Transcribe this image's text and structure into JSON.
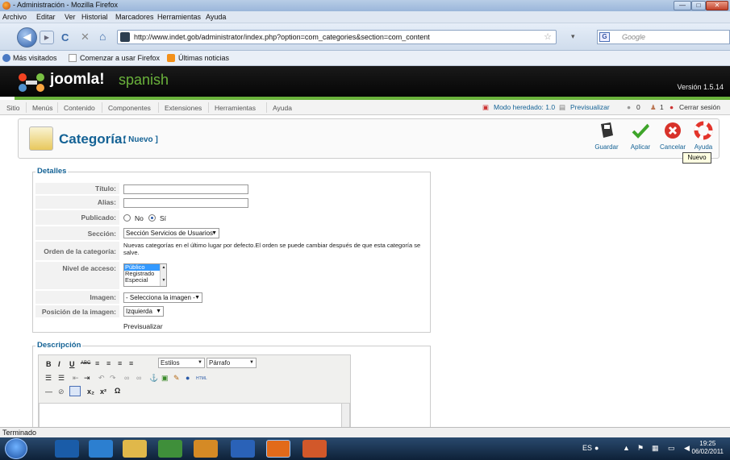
{
  "window": {
    "title": "- Administración - Mozilla Firefox",
    "min": "—",
    "max": "□",
    "close": "✕"
  },
  "menubar": [
    "Archivo",
    "Editar",
    "Ver",
    "Historial",
    "Marcadores",
    "Herramientas",
    "Ayuda"
  ],
  "nav": {
    "back": "◀",
    "forward": "▶",
    "reload": "C",
    "stop": "✕",
    "home": "⌂",
    "url": "http://www.indet.gob/administrator/index.php?option=com_categories&section=com_content",
    "search_placeholder": "Google"
  },
  "bookmarks": [
    "Más visitados",
    "Comenzar a usar Firefox",
    "Últimas noticias"
  ],
  "joomla": {
    "logo_main": "joomla!",
    "logo_sub": "spanish",
    "version": "Versión 1.5.14",
    "menu": [
      "Sitio",
      "Menús",
      "Contenido",
      "Componentes",
      "Extensiones",
      "Herramientas",
      "Ayuda"
    ],
    "status": {
      "legacy": "Modo heredado: 1.0",
      "preview": "Previsualizar",
      "messages": "0",
      "users": "1",
      "logout": "Cerrar sesión"
    }
  },
  "toolbar": {
    "title": "Categoría:",
    "subtitle": "[ Nuevo ]",
    "buttons": [
      {
        "label": "Guardar",
        "icon": "save-icon"
      },
      {
        "label": "Aplicar",
        "icon": "apply-icon"
      },
      {
        "label": "Cancelar",
        "icon": "cancel-icon"
      },
      {
        "label": "Ayuda",
        "icon": "help-icon"
      }
    ],
    "tooltip": "Nuevo"
  },
  "detalles": {
    "legend": "Detalles",
    "titulo_label": "Título:",
    "alias_label": "Alias:",
    "publicado_label": "Publicado:",
    "publicado_no": "No",
    "publicado_si": "Sí",
    "publicado_value": "Sí",
    "seccion_label": "Sección:",
    "seccion_value": "Sección Servicios de Usuarios",
    "orden_label": "Orden de la categoría:",
    "orden_text": "Nuevas categorías en el último lugar por defecto.El orden se puede cambiar después de que esta categoría se salve.",
    "nivel_label": "Nivel de acceso:",
    "nivel_options": [
      "Público",
      "Registrado",
      "Especial"
    ],
    "nivel_selected": "Público",
    "imagen_label": "Imagen:",
    "imagen_value": "- Selecciona la imagen -",
    "posicion_label": "Posición de la imagen:",
    "posicion_value": "Izquierda",
    "previsualizar": "Previsualizar"
  },
  "descripcion": {
    "legend": "Descripción",
    "styles_label": "Estilos",
    "format_label": "Párrafo"
  },
  "statusbar": "Terminado",
  "taskbar": {
    "lang": "ES",
    "time": "19:25",
    "date": "06/02/2011"
  }
}
